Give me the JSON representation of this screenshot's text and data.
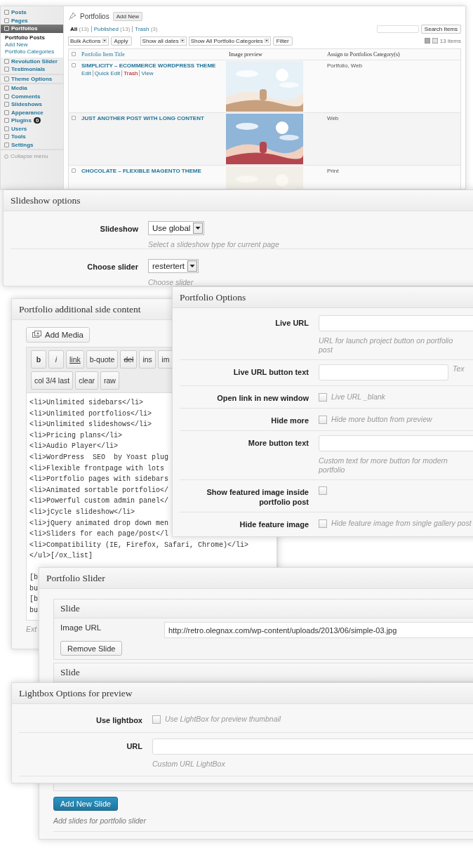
{
  "admin": {
    "sidebar": {
      "groups": [
        {
          "items": [
            {
              "label": "Posts",
              "selected": false
            },
            {
              "label": "Pages",
              "selected": false
            },
            {
              "label": "Portfolios",
              "selected": true,
              "children": [
                {
                  "label": "Portfolio Posts",
                  "selected": true
                },
                {
                  "label": "Add New",
                  "selected": false
                },
                {
                  "label": "Portfolio Categories",
                  "selected": false
                }
              ]
            },
            {
              "label": "Revolution Slider",
              "selected": false
            },
            {
              "label": "Testimonials",
              "selected": false
            }
          ]
        },
        {
          "items": [
            {
              "label": "Theme Options",
              "selected": false
            }
          ]
        },
        {
          "items": [
            {
              "label": "Media",
              "selected": false
            },
            {
              "label": "Comments",
              "selected": false
            },
            {
              "label": "Slideshows",
              "selected": false
            },
            {
              "label": "Appearance",
              "selected": false
            },
            {
              "label": "Plugins",
              "selected": false,
              "badge": "0"
            },
            {
              "label": "Users",
              "selected": false
            },
            {
              "label": "Tools",
              "selected": false
            },
            {
              "label": "Settings",
              "selected": false
            }
          ]
        }
      ],
      "collapse": "Collapse menu"
    },
    "page_title": "Portfolios",
    "add_new": "Add New",
    "status_filters": [
      {
        "label": "All",
        "count": "(13)",
        "selected": true
      },
      {
        "label": "Published",
        "count": "(13)",
        "selected": false
      },
      {
        "label": "Trash",
        "count": "(3)",
        "selected": false
      }
    ],
    "search": {
      "button": "Search Items"
    },
    "filters": {
      "bulk_actions": "Bulk Actions",
      "apply": "Apply",
      "dates": "Show all dates",
      "categories": "Show All Portfolio Categories",
      "filter": "Filter"
    },
    "view_modes": [
      {
        "kind": "list",
        "selected": true
      },
      {
        "kind": "excerpt",
        "selected": false
      }
    ],
    "item_count": "13 items",
    "table": {
      "select_all": {
        "checked": false
      },
      "columns": [
        "Portfolio Item Title",
        "Image preview",
        "Assign to Portfolios Category(s)"
      ],
      "rows": [
        {
          "checked": false,
          "title": "SIMPLICITY – ECOMMERCE WORDPRESS THEME",
          "actions": [
            {
              "label": "Edit",
              "kind": "link"
            },
            {
              "label": "Quick Edit",
              "kind": "link"
            },
            {
              "label": "Trash",
              "kind": "danger"
            },
            {
              "label": "View",
              "kind": "link"
            }
          ],
          "preview": {
            "kind": "picture"
          },
          "categories": "Portfolio, Web"
        },
        {
          "checked": false,
          "title": "JUST ANOTHER POST WITH LONG CONTENT",
          "preview": {
            "kind": "picture"
          },
          "categories": "Web"
        },
        {
          "checked": false,
          "title": "CHOCOLATE – FLEXIBLE MAGENTO THEME",
          "preview": {
            "kind": "picture"
          },
          "categories": "Print"
        }
      ]
    }
  },
  "slideshow_options": {
    "title": "Slideshow options",
    "rows": [
      {
        "label": "Slideshow",
        "value": "Use global",
        "hint": "Select a slideshow type for current page"
      },
      {
        "label": "Choose slider",
        "value": "restertert",
        "hint": "Choose slider"
      }
    ]
  },
  "side_content": {
    "title": "Portfolio additional side content",
    "add_media": "Add Media",
    "toolbar": [
      [
        "b",
        "i",
        "link",
        "b-quote",
        "del",
        "ins",
        "im"
      ],
      [
        "col 3/4 last",
        "clear",
        "raw"
      ]
    ],
    "code_lines": [
      "<li>Unlimited sidebars</li>",
      "<li>Unlimited portfolios</li>",
      "<li>Unlimited slideshows</li>",
      "<li>Pricing plans</li>",
      "<li>Audio Player</li>",
      "<li>WordPress  SEO  by Yoast plug",
      "<li>Flexible frontpage with lots",
      "<li>Portfolio pages with sidebars",
      "<li>Animated sortable portfolio</",
      "<li>Powerful custom admin panel</",
      "<li>jCycle slideshow</li>",
      "<li>jQuery animated drop down men",
      "<li>Sliders for each page/post</l",
      "<li>Compatibility (IE, Firefox, Safari, Chrome)</li>",
      "</ul>[/ox_list]"
    ],
    "code_tail": [
      "[b",
      "bu",
      "[b",
      "bu"
    ],
    "hint": "Ext"
  },
  "portfolio_options": {
    "title": "Portfolio Options",
    "rows": [
      {
        "kind": "text",
        "label": "Live URL",
        "hint": "URL for launch project button on portfolio post"
      },
      {
        "kind": "short_text",
        "label": "Live URL button text",
        "note": "Tex"
      },
      {
        "kind": "checkbox",
        "label": "Open link in new window",
        "checked": false,
        "note": "Live URL _blank"
      },
      {
        "kind": "checkbox",
        "label": "Hide more",
        "checked": false,
        "note": "Hide more button from preview"
      },
      {
        "kind": "text",
        "label": "More button text",
        "hint": "Custom text for more button for modern portfolio"
      },
      {
        "kind": "checkbox",
        "label": "Show featured image inside portfolio post",
        "checked": false
      },
      {
        "kind": "checkbox",
        "label": "Hide feature image",
        "checked": false,
        "note": "Hide feature image from single gallery post"
      }
    ]
  },
  "portfolio_slider": {
    "title": "Portfolio Slider",
    "slides": [
      {
        "title": "Slide",
        "url_label": "Image URL",
        "url": "http://retro.olegnax.com/wp-content/uploads/2013/06/simple-03.jpg",
        "remove": "Remove Slide"
      },
      {
        "title": "Slide"
      }
    ],
    "add_button": "Add New Slide",
    "hint": "Add slides for portfolio slider"
  },
  "lightbox_options": {
    "title": "Lightbox Options for preview",
    "rows": [
      {
        "kind": "checkbox",
        "label": "Use lightbox",
        "checked": false,
        "note": "Use LightBox for preview thumbnail"
      },
      {
        "kind": "text",
        "label": "URL",
        "hint": "Custom URL LightBox"
      }
    ]
  }
}
